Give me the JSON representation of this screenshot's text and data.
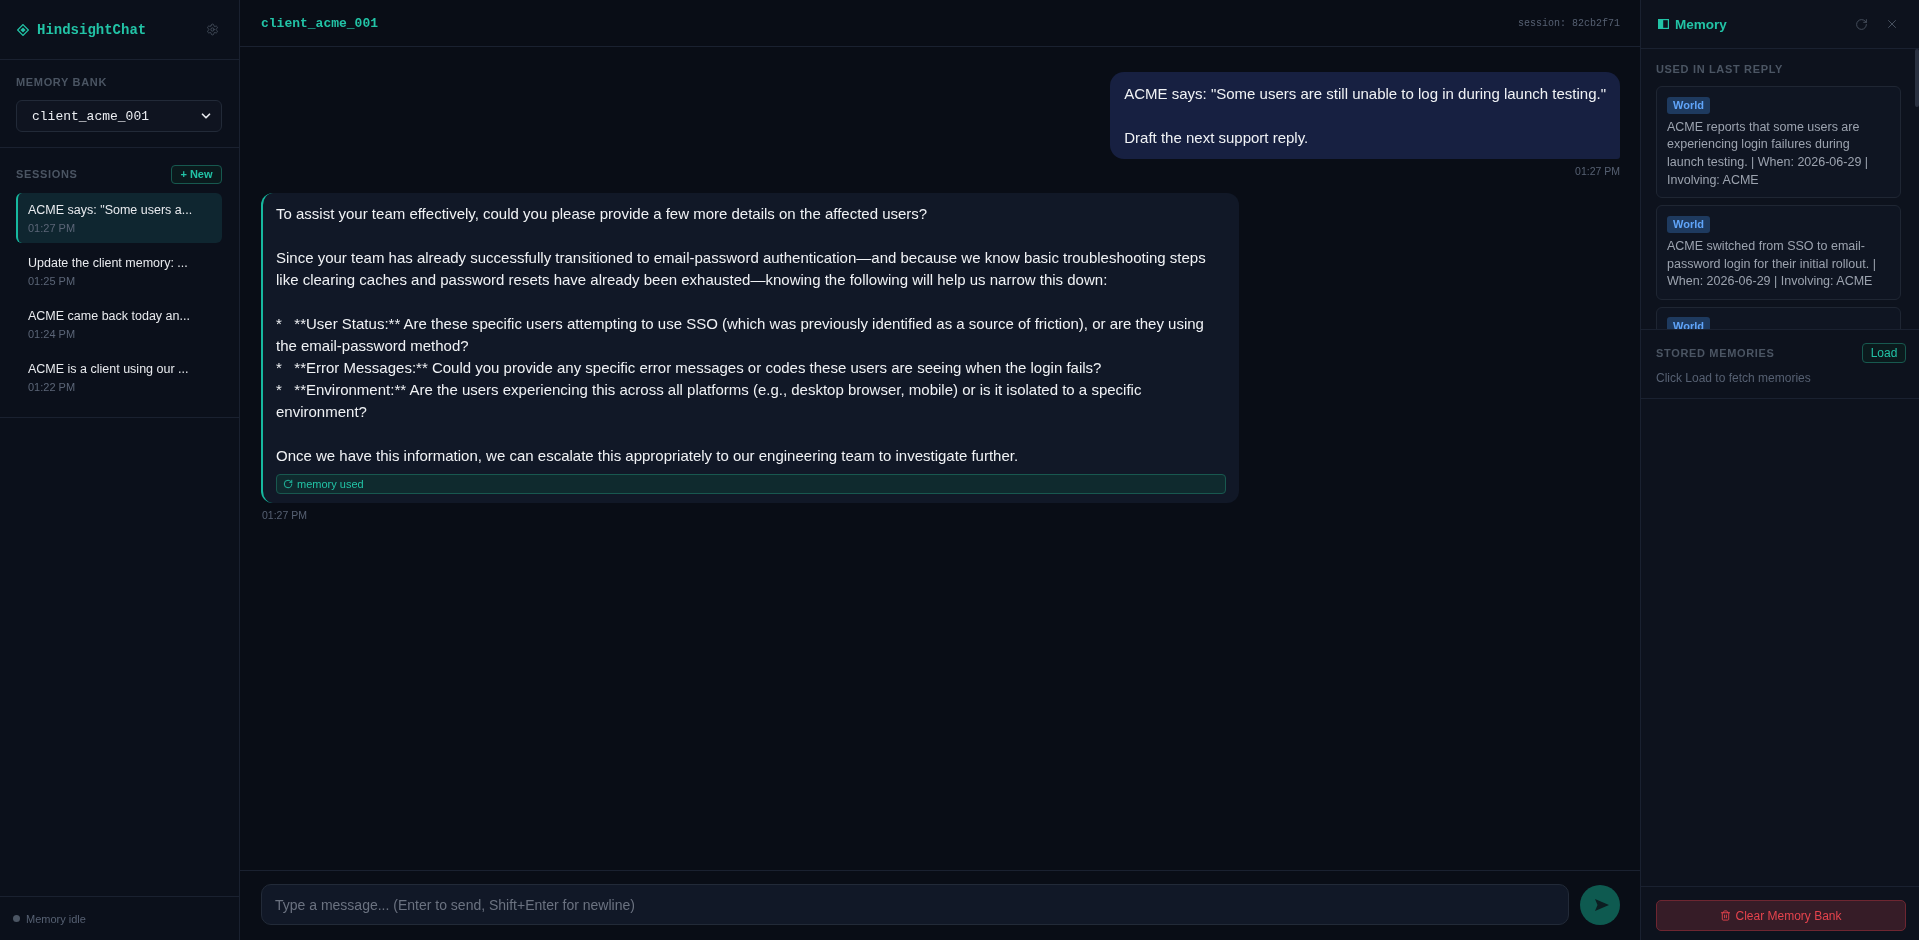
{
  "sidebar": {
    "brand": "HindsightChat",
    "memory_bank": {
      "label": "MEMORY BANK",
      "value": "client_acme_001"
    },
    "sessions": {
      "label": "SESSIONS",
      "new_button": "+ New",
      "items": [
        {
          "title": "ACME says: \"Some users a...",
          "time": "01:27 PM",
          "selected": true
        },
        {
          "title": "Update the client memory: ...",
          "time": "01:25 PM",
          "selected": false
        },
        {
          "title": "ACME came back today an...",
          "time": "01:24 PM",
          "selected": false
        },
        {
          "title": "ACME is a client using our ...",
          "time": "01:22 PM",
          "selected": false
        }
      ]
    },
    "status": "Memory idle"
  },
  "chat": {
    "title": "client_acme_001",
    "session": "session: 82cb2f71",
    "messages": [
      {
        "kind": "user",
        "blocks": [
          [
            "ACME says: \"Some users are still unable to log in during launch testing.\""
          ],
          [
            "Draft the next support reply."
          ]
        ],
        "time": "01:27 PM"
      },
      {
        "kind": "assistant",
        "blocks": [
          [
            "To assist your team effectively, could you please provide a few more details on the affected users?"
          ],
          [
            "Since your team has already successfully transitioned to email-password authentication—and because we know basic troubleshooting steps like clearing caches and password resets have already been exhausted—knowing the following will help us narrow this down:"
          ],
          [
            "*   **User Status:** Are these specific users attempting to use SSO (which was previously identified as a source of friction), or are they using the email-password method?",
            "*   **Error Messages:** Could you provide any specific error messages or codes these users are seeing when the login fails?",
            "*   **Environment:** Are the users experiencing this across all platforms (e.g., desktop browser, mobile) or is it isolated to a specific environment?"
          ],
          [
            "Once we have this information, we can escalate this appropriately to our engineering team to investigate further."
          ]
        ],
        "tag": "memory used",
        "time": "01:27 PM"
      }
    ],
    "input": {
      "placeholder": "Type a message... (Enter to send, Shift+Enter for newline)"
    }
  },
  "memory_panel": {
    "title": "Memory",
    "used": {
      "label": "USED IN LAST REPLY",
      "items": [
        {
          "tag": "World",
          "text": "ACME reports that some users are experiencing login failures during launch testing. | When: 2026-06-29 | Involving: ACME"
        },
        {
          "tag": "World",
          "text": "ACME switched from SSO to email-password login for their initial rollout. | When: 2026-06-29 | Involving: ACME"
        },
        {
          "tag": "World"
        }
      ]
    },
    "stored": {
      "label": "STORED MEMORIES",
      "load_button": "Load",
      "hint": "Click Load to fetch memories"
    },
    "clear_button": "Clear Memory Bank"
  }
}
